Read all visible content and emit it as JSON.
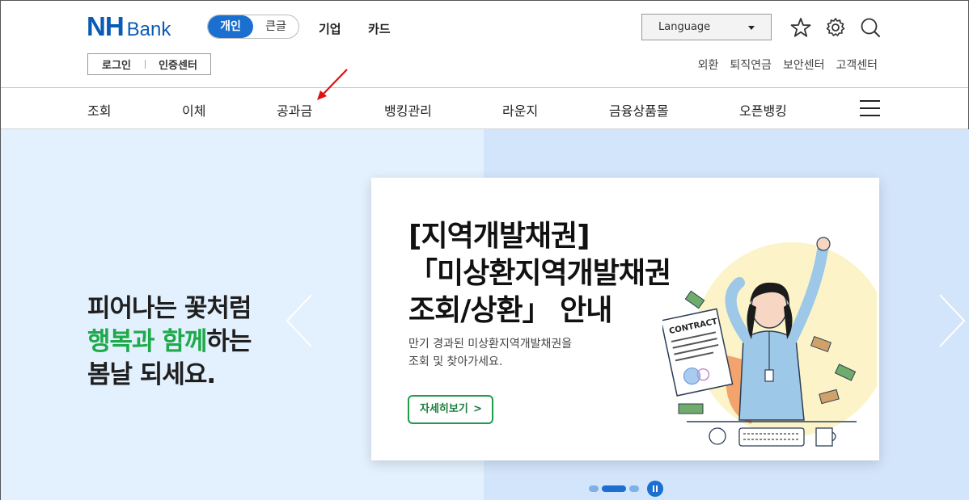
{
  "header": {
    "logo_nh": "NH",
    "logo_bank": "Bank",
    "segment": {
      "personal": "개인",
      "large_text": "큰글"
    },
    "top_menu": [
      "기업",
      "카드"
    ],
    "language": "Language",
    "login": "로그인",
    "cert_center": "인증센터",
    "utils": [
      "외환",
      "퇴직연금",
      "보안센터",
      "고객센터"
    ]
  },
  "gnb": [
    "조회",
    "이체",
    "공과금",
    "뱅킹관리",
    "라운지",
    "금융상품몰",
    "오픈뱅킹"
  ],
  "hero": {
    "slogan_line1": "피어나는 꽃처럼",
    "slogan_green": "행복과 함께",
    "slogan_line2_rest": "하는",
    "slogan_line3": "봄날 되세요.",
    "card": {
      "title_line1": "[지역개발채권]",
      "title_line2": "「미상환지역개발채권",
      "title_line3": "조회/상환」 안내",
      "desc_line1": "만기 경과된 미상환지역개발채권을",
      "desc_line2": "조회 및 찾아가세요.",
      "button": "자세히보기",
      "button_chevron": ">",
      "illust_label": "CONTRACT"
    }
  },
  "colors": {
    "brand": "#0a5bb5",
    "accent_blue": "#1a6fd0",
    "green": "#1eaa4b"
  }
}
